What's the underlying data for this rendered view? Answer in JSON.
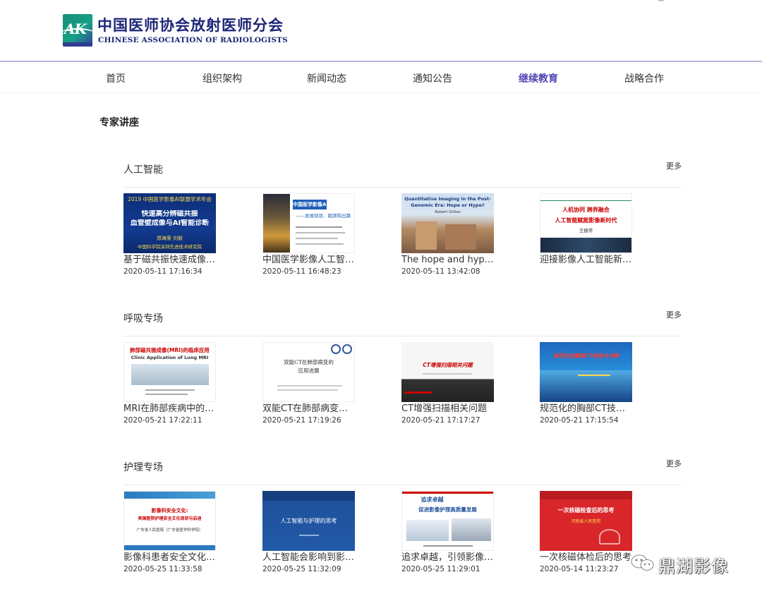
{
  "header": {
    "logo_letters": "AK",
    "org_name_cn": "中国医师协会放射医师分会",
    "org_name_en": "CHINESE ASSOCIATION OF RADIOLOGISTS"
  },
  "nav": {
    "items": [
      {
        "label": "首页"
      },
      {
        "label": "组织架构"
      },
      {
        "label": "新闻动态"
      },
      {
        "label": "通知公告"
      },
      {
        "label": "继续教育",
        "active": true
      },
      {
        "label": "战略合作"
      }
    ]
  },
  "page_title": "专家讲座",
  "more_label": "更多",
  "sections": [
    {
      "title": "人工智能",
      "cards": [
        {
          "title": "基于磁共振快速成像与AI智能诊断",
          "date": "2020-05-11 17:16:34",
          "thumb_lines": [
            "2019 中国医学影像AI联盟学术年会",
            "快速高分辨磁共振",
            "血管壁成像与AI智能诊断",
            "郑海荣 刘新",
            "中国科学院深圳先进技术研究院"
          ]
        },
        {
          "title": "中国医学影像人工智能发展现状",
          "date": "2020-05-11 16:48:23",
          "thumb_lines": [
            "中国医学影像AI",
            "——发展现状、瓶颈和出路"
          ]
        },
        {
          "title": "The hope and hype of quantitative imaging",
          "date": "2020-05-11 13:42:08",
          "thumb_lines": [
            "Quantitative Imaging in the Post-",
            "Genomic Era:  Hope or Hype?",
            "Robert Gillies"
          ]
        },
        {
          "title": "迎接影像人工智能新时代",
          "date": "",
          "thumb_lines": [
            "人机协同  跨界融合",
            "人工智能赋能影像新时代",
            "王振常"
          ]
        }
      ]
    },
    {
      "title": "呼吸专场",
      "cards": [
        {
          "title": "MRI在肺部疾病中的临床应用",
          "date": "2020-05-21 17:22:11",
          "thumb_lines": [
            "肺部磁共振成像(MRI)的临床应用",
            "Clinic Application of Lung MRI"
          ]
        },
        {
          "title": "双能CT在肺部病变的应用进展",
          "date": "2020-05-21 17:19:26",
          "thumb_lines": [
            "双能CT在肺部病变的",
            "应用进展"
          ]
        },
        {
          "title": "CT增强扫描相关问题",
          "date": "2020-05-21 17:17:27",
          "thumb_lines": [
            "CT增强扫描相关问题"
          ]
        },
        {
          "title": "规范化的胸部CT技术与诊断",
          "date": "2020-05-21 17:15:54",
          "thumb_lines": [
            "规范化的胸部CT检查与诊断"
          ]
        }
      ]
    },
    {
      "title": "护理专场",
      "cards": [
        {
          "title": "影像科患者安全文化建设",
          "date": "2020-05-25 11:33:58",
          "thumb_lines": [
            "影像科安全文化:",
            "美国医院护理安全文化现状与启迪",
            "广东省人民医院（广东省医学科学院）"
          ]
        },
        {
          "title": "人工智能会影响到影像护理吗",
          "date": "2020-05-25 11:32:09",
          "thumb_lines": [
            "人工智能与护理的思考"
          ]
        },
        {
          "title": "追求卓越，引领影像护理高质量发展",
          "date": "2020-05-25 11:29:01",
          "thumb_lines": [
            "追求卓越",
            "促进影像护理高质量发展"
          ]
        },
        {
          "title": "一次核磁体检后的思考",
          "date": "2020-05-14 11:23:27",
          "thumb_lines": [
            "一次核磁检查后的思考",
            "河南省人民医院"
          ]
        }
      ]
    }
  ],
  "watermark": {
    "text": "鼎湖影像"
  }
}
